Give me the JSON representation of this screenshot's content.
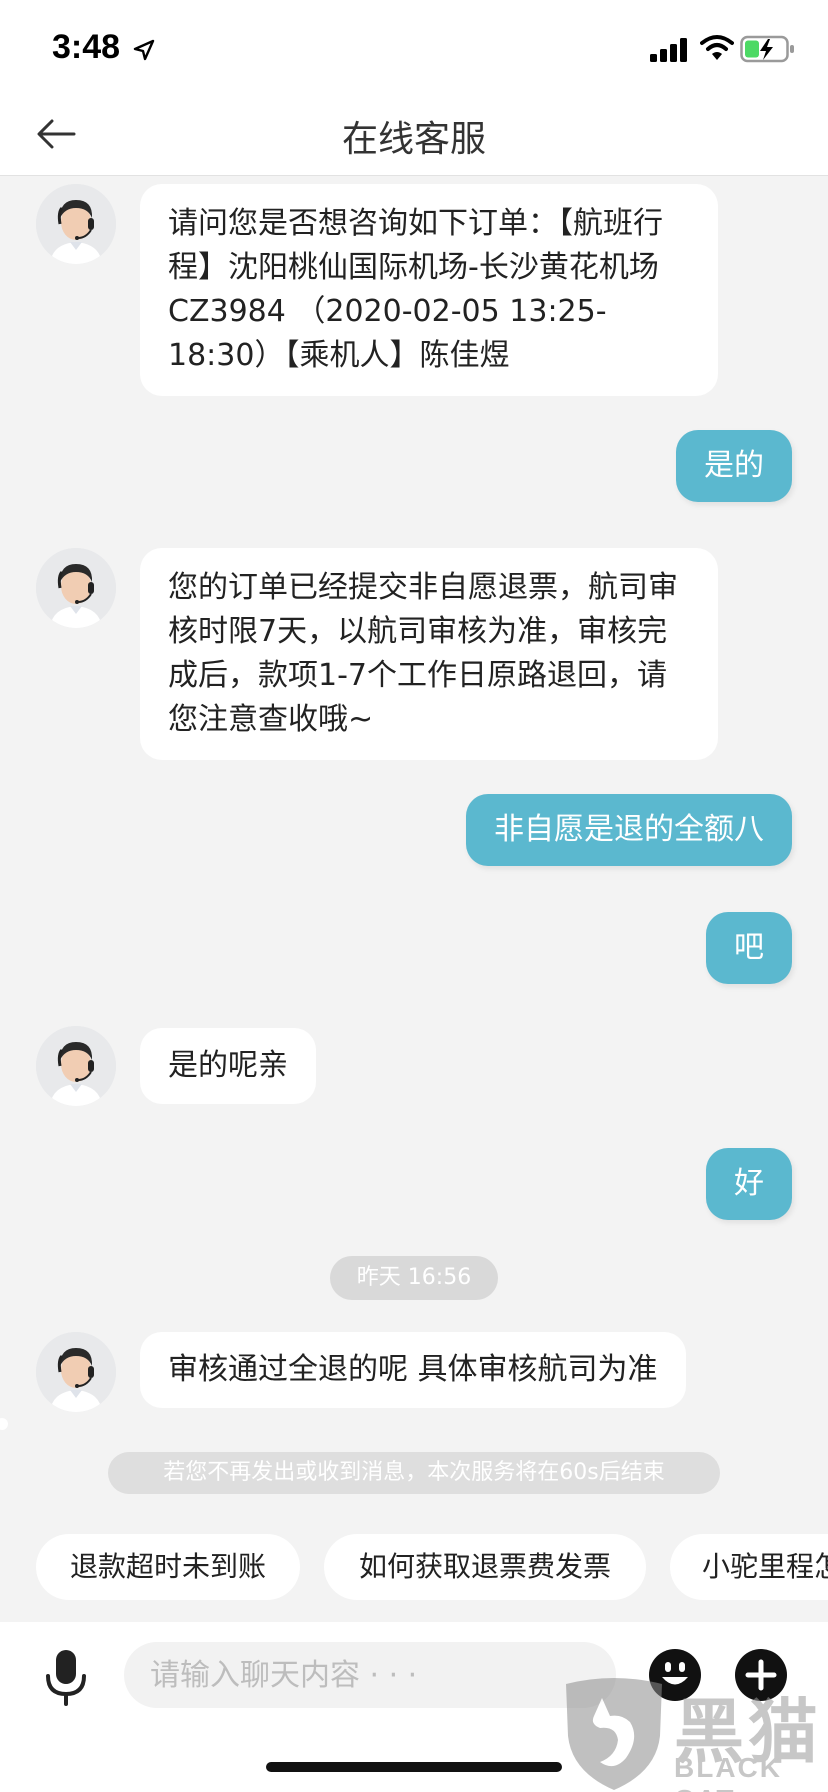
{
  "status_bar": {
    "time": "3:48",
    "icons": [
      "location-arrow-icon",
      "cell-signal-icon",
      "wifi-icon",
      "battery-charging-icon"
    ]
  },
  "nav": {
    "title": "在线客服",
    "back_icon": "back-arrow-icon"
  },
  "messages": [
    {
      "from": "agent",
      "text": "请问您是否想咨询如下订单：【航班行程】沈阳桃仙国际机场-长沙黄花机场 CZ3984 （2020-02-05 13:25-18:30）【乘机人】陈佳煜"
    },
    {
      "from": "user",
      "text": "是的"
    },
    {
      "from": "agent",
      "text": "您的订单已经提交非自愿退票，航司审核时限7天，以航司审核为准，审核完成后，款项1-7个工作日原路退回，请您注意查收哦~"
    },
    {
      "from": "user",
      "text": "非自愿是退的全额八"
    },
    {
      "from": "user",
      "text": "吧"
    },
    {
      "from": "agent",
      "text": "是的呢亲"
    },
    {
      "from": "user",
      "text": "好"
    },
    {
      "from": "agent",
      "text": "审核通过全退的呢 具体审核航司为准"
    }
  ],
  "time_separator": "昨天 16:56",
  "notice": "若您不再发出或收到消息，本次服务将在60s后结束",
  "quick_replies": [
    "退款超时未到账",
    "如何获取退票费发票",
    "小驼里程怎"
  ],
  "input": {
    "placeholder": "请输入聊天内容 · · ·",
    "value": "",
    "left_icon": "microphone-icon",
    "right_icons": [
      "emoji-icon",
      "plus-icon"
    ]
  },
  "watermark": {
    "cn": "黑猫",
    "en": "BLACK CAT"
  },
  "colors": {
    "user_bubble": "#5bb8cf",
    "agent_bubble": "#ffffff",
    "background": "#f3f3f3"
  }
}
